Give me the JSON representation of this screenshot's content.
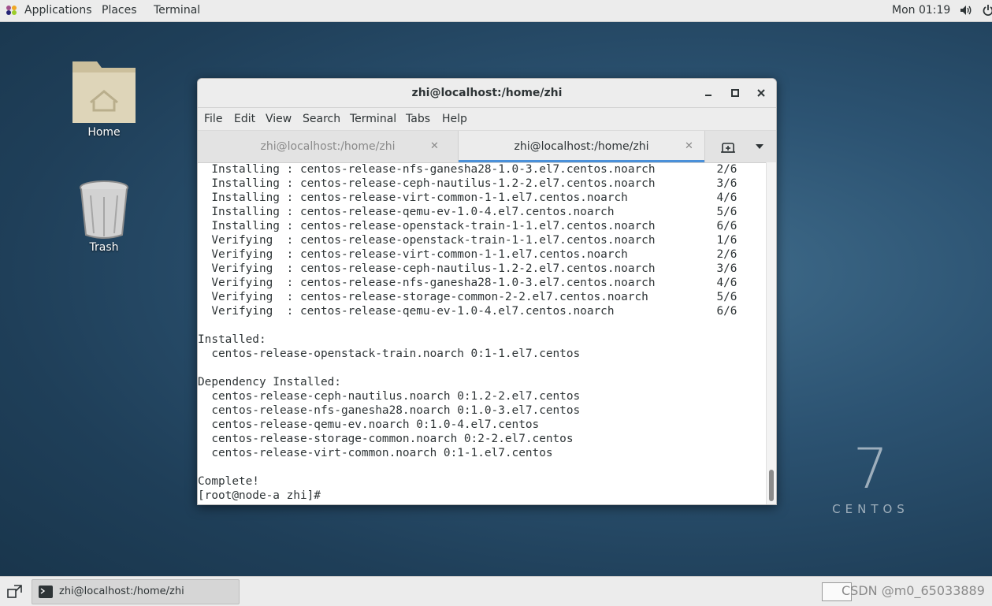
{
  "topbar": {
    "applications": "Applications",
    "places": "Places",
    "terminal": "Terminal",
    "clock": "Mon 01:19"
  },
  "desktop": {
    "home_label": "Home",
    "trash_label": "Trash",
    "logo_number": "7",
    "logo_text": "CENTOS"
  },
  "window": {
    "title": "zhi@localhost:/home/zhi",
    "menu": [
      "File",
      "Edit",
      "View",
      "Search",
      "Terminal",
      "Tabs",
      "Help"
    ],
    "tabs": [
      {
        "label": "zhi@localhost:/home/zhi",
        "active": false
      },
      {
        "label": "zhi@localhost:/home/zhi",
        "active": true
      }
    ],
    "lines": [
      "  Installing : centos-release-nfs-ganesha28-1.0-3.el7.centos.noarch         2/6",
      "  Installing : centos-release-ceph-nautilus-1.2-2.el7.centos.noarch         3/6",
      "  Installing : centos-release-virt-common-1-1.el7.centos.noarch             4/6",
      "  Installing : centos-release-qemu-ev-1.0-4.el7.centos.noarch               5/6",
      "  Installing : centos-release-openstack-train-1-1.el7.centos.noarch         6/6",
      "  Verifying  : centos-release-openstack-train-1-1.el7.centos.noarch         1/6",
      "  Verifying  : centos-release-virt-common-1-1.el7.centos.noarch             2/6",
      "  Verifying  : centos-release-ceph-nautilus-1.2-2.el7.centos.noarch         3/6",
      "  Verifying  : centos-release-nfs-ganesha28-1.0-3.el7.centos.noarch         4/6",
      "  Verifying  : centos-release-storage-common-2-2.el7.centos.noarch          5/6",
      "  Verifying  : centos-release-qemu-ev-1.0-4.el7.centos.noarch               6/6",
      "",
      "Installed:",
      "  centos-release-openstack-train.noarch 0:1-1.el7.centos",
      "",
      "Dependency Installed:",
      "  centos-release-ceph-nautilus.noarch 0:1.2-2.el7.centos",
      "  centos-release-nfs-ganesha28.noarch 0:1.0-3.el7.centos",
      "  centos-release-qemu-ev.noarch 0:1.0-4.el7.centos",
      "  centos-release-storage-common.noarch 0:2-2.el7.centos",
      "  centos-release-virt-common.noarch 0:1-1.el7.centos",
      "",
      "Complete!",
      "[root@node-a zhi]# "
    ]
  },
  "taskbar": {
    "task_label": "zhi@localhost:/home/zhi",
    "watermark": "CSDN @m0_65033889"
  }
}
